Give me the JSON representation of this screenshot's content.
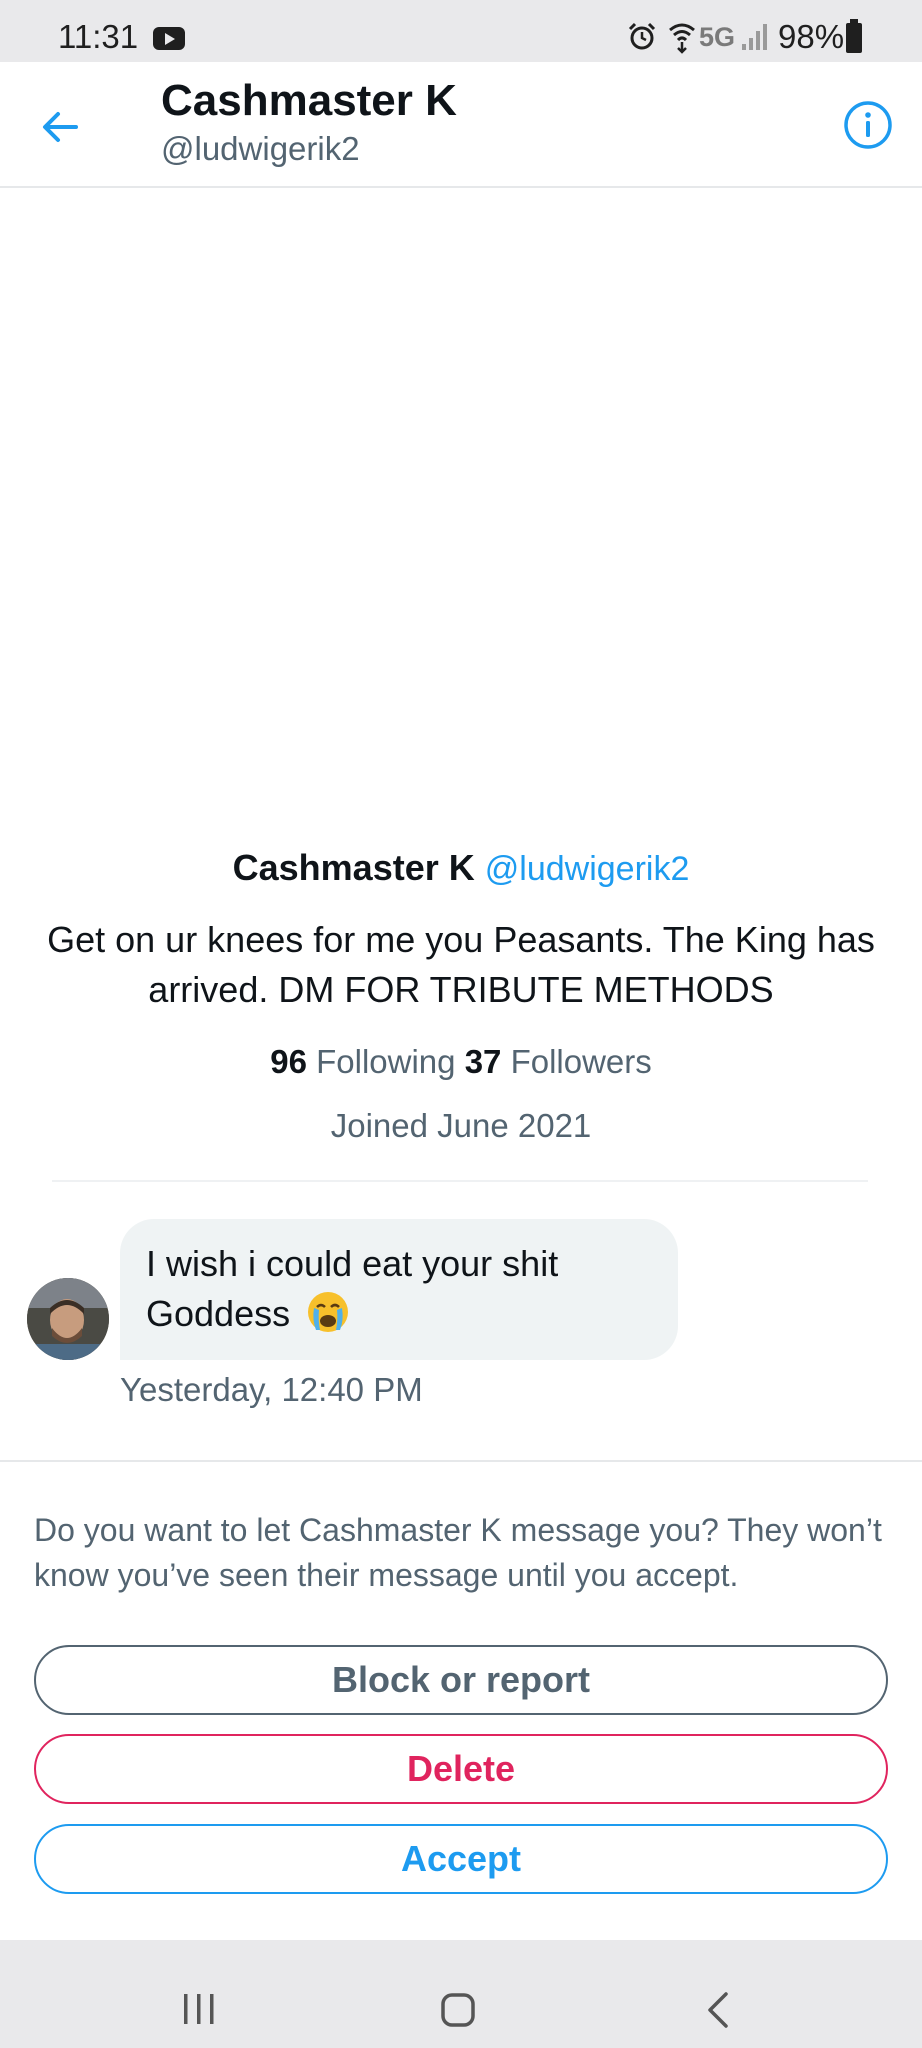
{
  "status_bar": {
    "time": "11:31",
    "network": "5G",
    "battery": "98%",
    "icons": [
      "youtube-icon",
      "alarm-icon",
      "wifi-icon",
      "signal-icon",
      "battery-icon"
    ]
  },
  "header": {
    "name": "Cashmaster K",
    "handle": "@ludwigerik2",
    "back_icon": "arrow-left-icon",
    "info_icon": "info-icon"
  },
  "profile": {
    "name": "Cashmaster K",
    "handle": "@ludwigerik2",
    "bio": "Get on ur knees for me you Peasants. The King has arrived. DM FOR TRIBUTE METHODS",
    "following_count": "96",
    "following_label": "Following",
    "followers_count": "37",
    "followers_label": "Followers",
    "joined": "Joined June 2021"
  },
  "message": {
    "text": "I wish i could eat your shit Goddess",
    "emoji": "loudly-crying-face-emoji",
    "timestamp": "Yesterday, 12:40 PM"
  },
  "request": {
    "prompt": "Do you want to let Cashmaster K message you? They won’t know you’ve seen their message until you accept.",
    "block_label": "Block or report",
    "delete_label": "Delete",
    "accept_label": "Accept"
  },
  "colors": {
    "accent": "#1d9bf0",
    "danger": "#e0245e",
    "secondary_text": "#536471"
  },
  "nav_bar": {
    "icons": [
      "recents-icon",
      "home-icon",
      "back-icon"
    ]
  }
}
